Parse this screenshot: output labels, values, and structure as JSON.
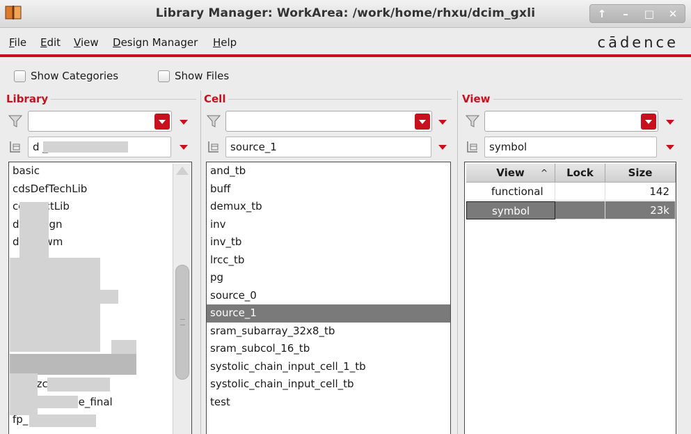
{
  "window": {
    "title": "Library Manager: WorkArea:  /work/home/rhxu/dcim_gxli",
    "controls": [
      "↑",
      "–",
      "□",
      "✕"
    ]
  },
  "menubar": {
    "items": [
      {
        "label": "File",
        "underline": "F",
        "rest": "ile"
      },
      {
        "label": "Edit",
        "underline": "E",
        "rest": "dit"
      },
      {
        "label": "View",
        "underline": "V",
        "rest": "iew"
      },
      {
        "label": "Design Manager",
        "underline": "D",
        "rest": "esign Manager"
      },
      {
        "label": "Help",
        "underline": "H",
        "rest": "elp"
      }
    ],
    "brand": "cādence"
  },
  "options": {
    "show_categories": "Show Categories",
    "show_files": "Show Files"
  },
  "library": {
    "title": "Library",
    "filter_value": "",
    "current": "d                 _tb",
    "items": [
      "basic",
      "cdsDefTechLib",
      "connectLib",
      "d      _design",
      "dc        tb_wm",
      "",
      "",
      "",
      "",
      "",
      "",
      "",
      "dci     zzc_2    5",
      "di     jon  ive      true_final",
      "fp_                   met",
      ""
    ]
  },
  "cell": {
    "title": "Cell",
    "filter_value": "",
    "current": "source_1",
    "items": [
      "and_tb",
      "buff",
      "demux_tb",
      "inv",
      "inv_tb",
      "lrcc_tb",
      "pg",
      "source_0",
      "source_1",
      "sram_subarray_32x8_tb",
      "sram_subcol_16_tb",
      "systolic_chain_input_cell_1_tb",
      "systolic_chain_input_cell_tb",
      "test"
    ],
    "selected_index": 8
  },
  "view": {
    "title": "View",
    "filter_value": "",
    "current": "symbol",
    "columns": [
      "View",
      "Lock",
      "Size"
    ],
    "sort_marker": "^",
    "rows": [
      {
        "view": "functional",
        "lock": "",
        "size": "142"
      },
      {
        "view": "symbol",
        "lock": "",
        "size": "23k"
      }
    ],
    "selected_index": 1
  },
  "colors": {
    "accent_red": "#c8101e",
    "selection_gray": "#7a7a7a"
  }
}
